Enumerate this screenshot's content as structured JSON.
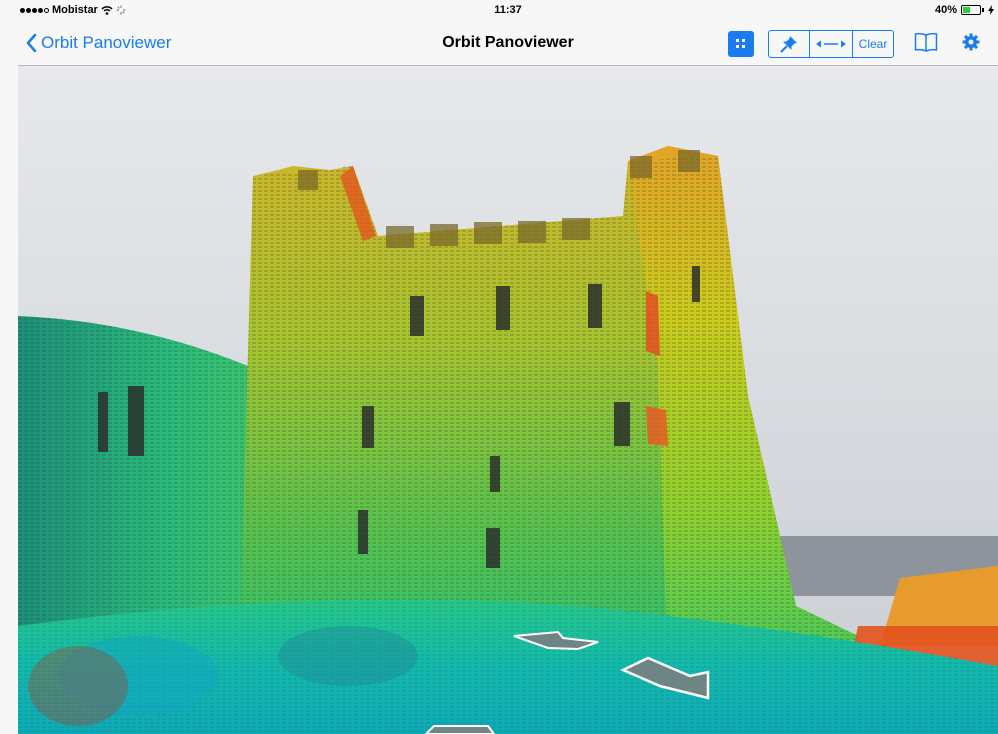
{
  "status_bar": {
    "carrier": "Mobistar",
    "time": "11:37",
    "battery_percent": "40%",
    "battery_level": 0.4,
    "icons": [
      "signal-dots-icon",
      "wifi-icon",
      "activity-spinner-icon",
      "battery-icon",
      "charging-bolt-icon"
    ]
  },
  "nav": {
    "back_label": "Orbit Panoviewer",
    "title": "Orbit Panoviewer",
    "clear_label": "Clear",
    "icons": [
      "chevron-left-icon",
      "grid-icon",
      "pin-icon",
      "measure-arrows-icon",
      "book-icon",
      "gear-icon"
    ]
  },
  "colors": {
    "accent": "#1a7cf0",
    "bar_background": "#f7f7f7",
    "point_cloud_palette": [
      "#0fb6b1",
      "#2cc67a",
      "#88d432",
      "#d8d21c",
      "#e6a12a",
      "#e64b1f"
    ]
  }
}
